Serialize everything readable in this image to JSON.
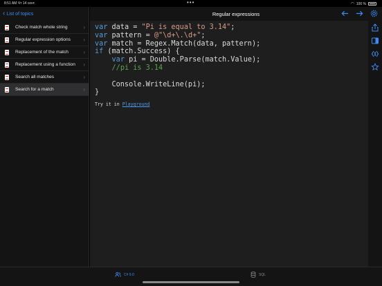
{
  "status": {
    "time": "8:51 AM",
    "date": "Чт 14 сент.",
    "battery": "100 %"
  },
  "sidebar": {
    "back_label": "List of topics",
    "items": [
      {
        "label": "Check match whole string",
        "selected": false
      },
      {
        "label": "Regular expression options",
        "selected": false
      },
      {
        "label": "Replacement of the match",
        "selected": false
      },
      {
        "label": "Replacement using a function",
        "selected": false
      },
      {
        "label": "Search all matches",
        "selected": false
      },
      {
        "label": "Search for a match",
        "selected": true
      }
    ]
  },
  "header": {
    "title": "Regular expressions"
  },
  "code": {
    "lines": [
      "var data = \"Pi is equal to 3.14\";",
      "var pattern = @\"\\d+\\.\\d+\";",
      "var match = Regex.Match(data, pattern);",
      "if (match.Success) {",
      "    var pi = Double.Parse(match.Value);",
      "    //pi is 3.14",
      "",
      "    Console.WriteLine(pi);",
      "}"
    ]
  },
  "try_it": {
    "prefix": "Try it in",
    "link": "Playground"
  },
  "tabs": [
    {
      "label": "C# 9.0",
      "active": true
    },
    {
      "label": "SQL",
      "active": false
    }
  ],
  "colors": {
    "accent": "#3d8cf5",
    "keyword": "#569cd6",
    "string": "#d69d85",
    "comment": "#57a64a"
  }
}
